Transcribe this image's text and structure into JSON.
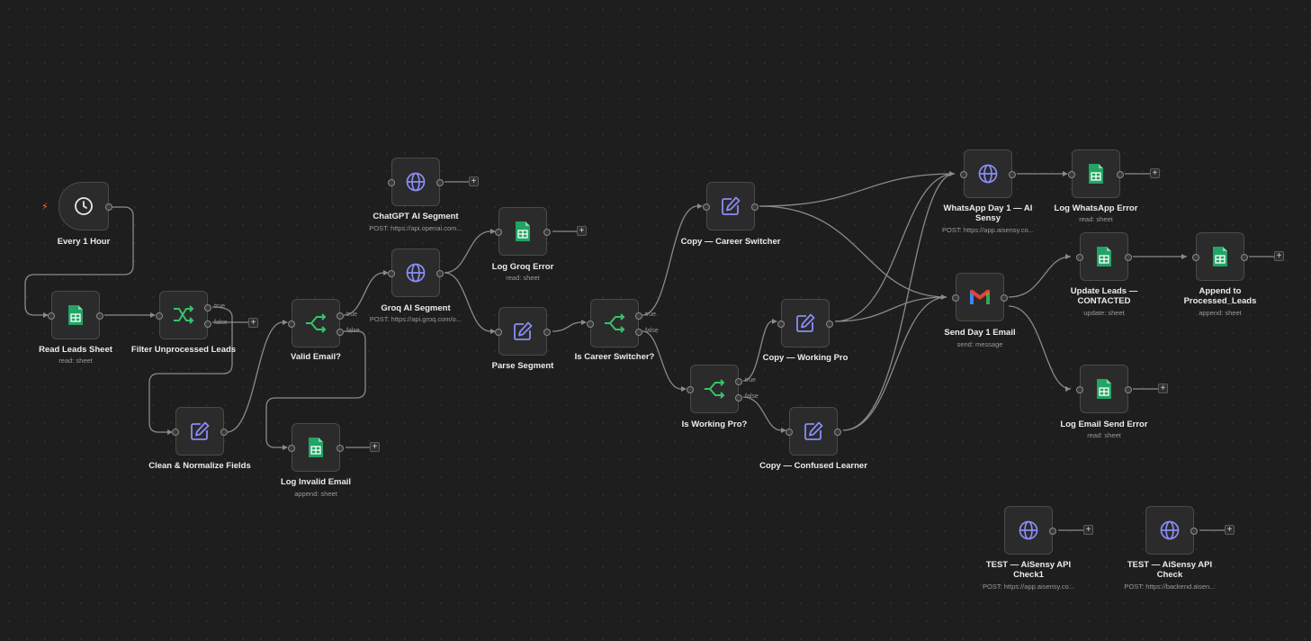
{
  "nodes": {
    "every_1_hour": {
      "title": "Every 1 Hour",
      "icon": "clock-icon"
    },
    "read_leads_sheet": {
      "title": "Read Leads Sheet",
      "subtitle": "read: sheet",
      "icon": "google-sheets-icon"
    },
    "filter_unprocessed": {
      "title": "Filter Unprocessed Leads",
      "icon": "filter-branch-icon",
      "true_label": "true",
      "false_label": "false"
    },
    "clean_normalize": {
      "title": "Clean & Normalize Fields",
      "icon": "edit-icon"
    },
    "valid_email": {
      "title": "Valid Email?",
      "icon": "if-branch-icon",
      "true_label": "true",
      "false_label": "false"
    },
    "log_invalid_email": {
      "title": "Log Invalid Email",
      "subtitle": "append: sheet",
      "icon": "google-sheets-icon"
    },
    "chatgpt_ai_segment": {
      "title": "ChatGPT AI Segment",
      "subtitle": "POST: https://api.openai.com...",
      "icon": "globe-icon"
    },
    "groq_ai_segment": {
      "title": "Groq AI Segment",
      "subtitle": "POST: https://api.groq.com/o...",
      "icon": "globe-icon"
    },
    "log_groq_error": {
      "title": "Log Groq Error",
      "subtitle": "read: sheet",
      "icon": "google-sheets-icon"
    },
    "parse_segment": {
      "title": "Parse Segment",
      "icon": "edit-icon"
    },
    "is_career_switcher": {
      "title": "Is Career Switcher?",
      "icon": "if-branch-icon",
      "true_label": "true",
      "false_label": "false"
    },
    "copy_career_switcher": {
      "title": "Copy — Career Switcher",
      "icon": "edit-icon"
    },
    "is_working_pro": {
      "title": "Is Working Pro?",
      "icon": "if-branch-icon",
      "true_label": "true",
      "false_label": "false"
    },
    "copy_working_pro": {
      "title": "Copy — Working Pro",
      "icon": "edit-icon"
    },
    "copy_confused_learner": {
      "title": "Copy — Confused Learner",
      "icon": "edit-icon"
    },
    "whatsapp_day1": {
      "title": "WhatsApp Day 1 — AI Sensy",
      "subtitle": "POST: https://app.aisensy.co...",
      "icon": "globe-icon"
    },
    "log_whatsapp_error": {
      "title": "Log WhatsApp Error",
      "subtitle": "read: sheet",
      "icon": "google-sheets-icon"
    },
    "send_day1_email": {
      "title": "Send Day 1 Email",
      "subtitle": "send: message",
      "icon": "gmail-icon"
    },
    "update_leads_contacted": {
      "title": "Update Leads — CONTACTED",
      "subtitle": "update: sheet",
      "icon": "google-sheets-icon"
    },
    "append_processed_leads": {
      "title": "Append to Processed_Leads",
      "subtitle": "append: sheet",
      "icon": "google-sheets-icon"
    },
    "log_email_send_error": {
      "title": "Log Email Send Error",
      "subtitle": "read: sheet",
      "icon": "google-sheets-icon"
    },
    "test_aisensy_check1": {
      "title": "TEST — AiSensy API Check1",
      "subtitle": "POST: https://app.aisensy.co...",
      "icon": "globe-icon"
    },
    "test_aisensy_check": {
      "title": "TEST — AiSensy API Check",
      "subtitle": "POST: https://backend.aisen...",
      "icon": "globe-icon"
    }
  },
  "ui": {
    "add_symbol": "+",
    "trigger_symbol": "⚡"
  },
  "colors": {
    "canvas": "#1e1e1e",
    "node_bg": "#2b2b2b",
    "edge": "#8a8a8a",
    "sheets_green": "#21a464",
    "branch_green": "#35c46a",
    "http_purple": "#8b8cf4",
    "trigger_orange": "#ff6d2d"
  }
}
